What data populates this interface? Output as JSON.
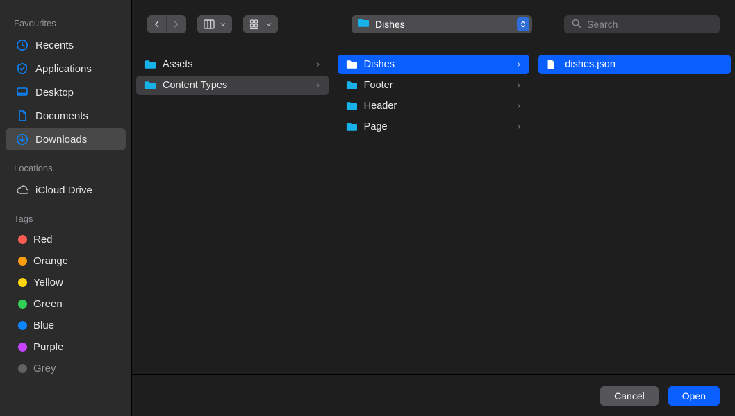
{
  "sidebar": {
    "sections": [
      {
        "title": "Favourites",
        "items": [
          {
            "label": "Recents",
            "icon": "clock",
            "selected": false
          },
          {
            "label": "Applications",
            "icon": "apps",
            "selected": false
          },
          {
            "label": "Desktop",
            "icon": "desktop",
            "selected": false
          },
          {
            "label": "Documents",
            "icon": "document",
            "selected": false
          },
          {
            "label": "Downloads",
            "icon": "download",
            "selected": true
          }
        ]
      },
      {
        "title": "Locations",
        "items": [
          {
            "label": "iCloud Drive",
            "icon": "cloud",
            "selected": false
          }
        ]
      },
      {
        "title": "Tags",
        "items": [
          {
            "label": "Red",
            "icon": "tag",
            "color": "#ff5b51"
          },
          {
            "label": "Orange",
            "icon": "tag",
            "color": "#ff9e0b"
          },
          {
            "label": "Yellow",
            "icon": "tag",
            "color": "#ffd50b"
          },
          {
            "label": "Green",
            "icon": "tag",
            "color": "#32d156"
          },
          {
            "label": "Blue",
            "icon": "tag",
            "color": "#0a84ff"
          },
          {
            "label": "Purple",
            "icon": "tag",
            "color": "#c644fc"
          },
          {
            "label": "Grey",
            "icon": "tag",
            "color": "#8e8e93"
          }
        ]
      }
    ]
  },
  "toolbar": {
    "path_label": "Dishes",
    "search_placeholder": "Search"
  },
  "columns": [
    {
      "items": [
        {
          "name": "Assets",
          "type": "folder",
          "selected": false,
          "has_children": true
        },
        {
          "name": "Content Types",
          "type": "folder",
          "selected": "grey",
          "has_children": true
        }
      ]
    },
    {
      "items": [
        {
          "name": "Dishes",
          "type": "folder",
          "selected": "blue",
          "has_children": true
        },
        {
          "name": "Footer",
          "type": "folder",
          "selected": false,
          "has_children": true
        },
        {
          "name": "Header",
          "type": "folder",
          "selected": false,
          "has_children": true
        },
        {
          "name": "Page",
          "type": "folder",
          "selected": false,
          "has_children": true
        }
      ]
    },
    {
      "items": [
        {
          "name": "dishes.json",
          "type": "file",
          "selected": "blue",
          "has_children": false
        }
      ]
    }
  ],
  "footer": {
    "cancel_label": "Cancel",
    "open_label": "Open"
  },
  "colors": {
    "accent": "#0a60ff",
    "sidebar_icon": "#0a84ff",
    "folder": "#16b2e8"
  }
}
